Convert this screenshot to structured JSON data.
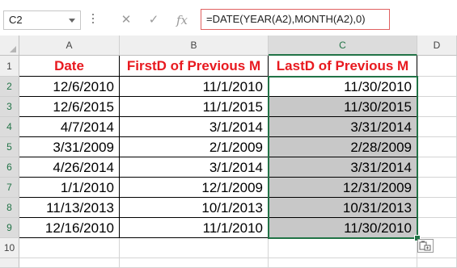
{
  "formula_bar": {
    "name_box": "C2",
    "cancel_icon": "x-icon",
    "enter_icon": "check-icon",
    "function_icon": "fx-icon",
    "cancel_glyph": "✕",
    "enter_glyph": "✓",
    "function_glyph": "fx",
    "formula": "=DATE(YEAR(A2),MONTH(A2),0)"
  },
  "columns": [
    "A",
    "B",
    "C",
    "D"
  ],
  "rows": [
    "1",
    "2",
    "3",
    "4",
    "5",
    "6",
    "7",
    "8",
    "9",
    "10"
  ],
  "headers": {
    "a": "Date",
    "b": "FirstD of Previous M",
    "c": "LastD of Previous M"
  },
  "data": [
    {
      "a": "12/6/2010",
      "b": "11/1/2010",
      "c": "11/30/2010"
    },
    {
      "a": "12/6/2015",
      "b": "11/1/2015",
      "c": "11/30/2015"
    },
    {
      "a": "4/7/2014",
      "b": "3/1/2014",
      "c": "3/31/2014"
    },
    {
      "a": "3/31/2009",
      "b": "2/1/2009",
      "c": "2/28/2009"
    },
    {
      "a": "4/26/2014",
      "b": "3/1/2014",
      "c": "3/31/2014"
    },
    {
      "a": "1/1/2010",
      "b": "12/1/2009",
      "c": "12/31/2009"
    },
    {
      "a": "11/13/2013",
      "b": "10/1/2013",
      "c": "10/31/2013"
    },
    {
      "a": "12/16/2010",
      "b": "11/1/2010",
      "c": "11/30/2010"
    }
  ],
  "colors": {
    "header_text": "#e8191f",
    "selection": "#217346",
    "selected_fill": "#c8c8c8"
  }
}
